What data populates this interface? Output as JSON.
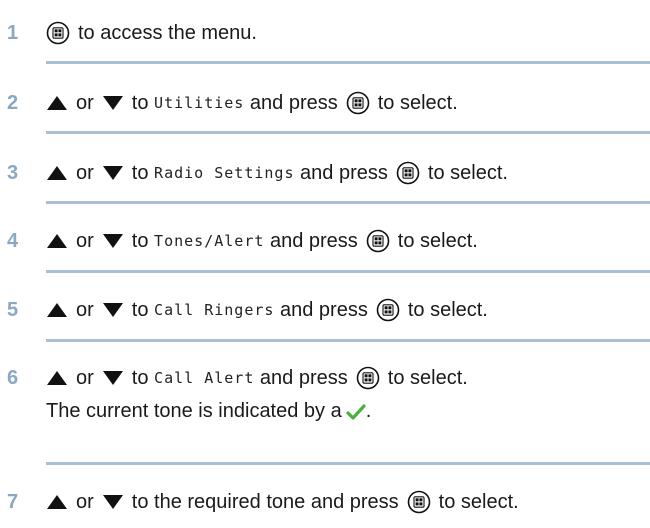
{
  "steps": [
    {
      "num": "1",
      "text": "to access the menu."
    },
    {
      "num": "2",
      "or": "or",
      "to": "to",
      "item": "Utilities",
      "press": "and press",
      "end": "to select."
    },
    {
      "num": "3",
      "or": "or",
      "to": "to",
      "item": "Radio Settings",
      "press": "and press",
      "end": "to select."
    },
    {
      "num": "4",
      "or": "or",
      "to": "to",
      "item": "Tones/Alert",
      "press": "and press",
      "end": "to select."
    },
    {
      "num": "5",
      "or": "or",
      "to": "to",
      "item": "Call Ringers",
      "press": "and press",
      "end": "to select."
    },
    {
      "num": "6",
      "or": "or",
      "to": "to",
      "item": "Call Alert",
      "press": "and press",
      "end": "to select."
    },
    {
      "num": "7",
      "or": "or",
      "to": "to the required tone",
      "press": "and press",
      "end": "to select."
    }
  ],
  "note": {
    "text": "The current tone is indicated by a",
    "end": "."
  },
  "icons": {
    "menu": "menu-ok-button-icon",
    "up": "up-arrow-icon",
    "down": "down-arrow-icon",
    "check": "checkmark-icon"
  },
  "colors": {
    "step_number": "#8aa7c4",
    "divider": "#a9bfd5",
    "check": "#4caf3a"
  }
}
